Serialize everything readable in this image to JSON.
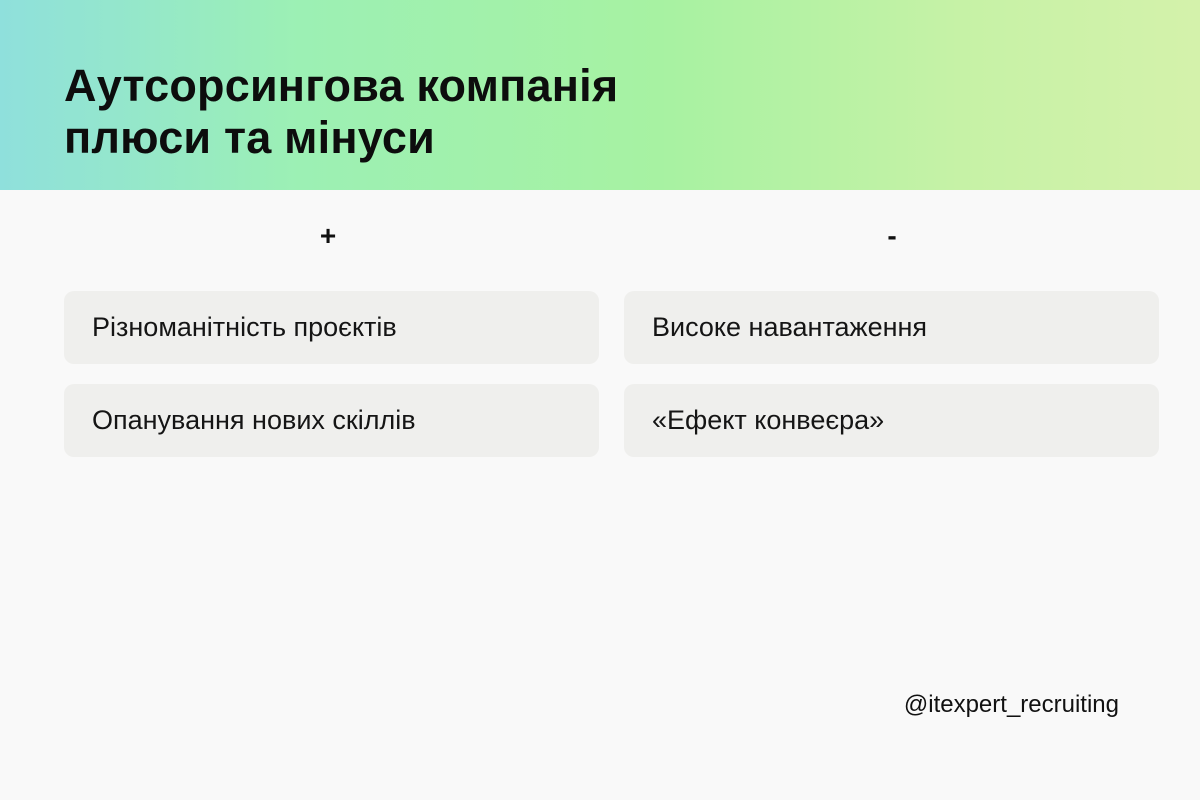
{
  "header": {
    "title_line1": "Аутсорсингова компанія",
    "title_line2": "плюси та мінуси",
    "gradient_colors": [
      "#8fe0dc",
      "#9cf0b4",
      "#a7f2a2",
      "#c6f2a6",
      "#d4f2ab"
    ]
  },
  "pros": {
    "heading": "+",
    "items": [
      "Різноманітність проєктів",
      "Опанування нових скіллів"
    ]
  },
  "cons": {
    "heading": "-",
    "items": [
      "Високе навантаження",
      "«Ефект конвеєра»"
    ]
  },
  "footer": {
    "handle": "@itexpert_recruiting"
  },
  "colors": {
    "background": "#f9f9f9",
    "card": "#efefed",
    "text": "#111111"
  }
}
